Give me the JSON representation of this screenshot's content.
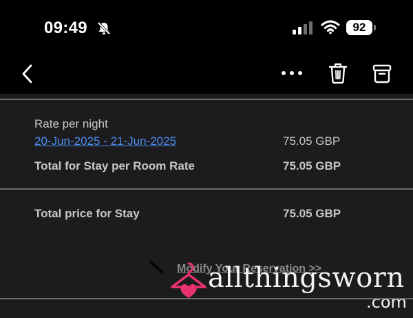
{
  "status_bar": {
    "time": "09:49",
    "battery": "92",
    "icons": [
      "bell-slash-icon",
      "cellular-signal-icon",
      "wifi-icon",
      "battery-icon"
    ]
  },
  "nav": {
    "icons": [
      "back-chevron-icon",
      "more-dots-icon",
      "trash-icon",
      "archive-icon"
    ]
  },
  "rate_section": {
    "heading": "Rate per night",
    "date_range": "20-Jun-2025 - 21-Jun-2025",
    "date_amount": "75.05 GBP",
    "total_label": "Total for Stay per Room Rate",
    "total_amount": "75.05 GBP"
  },
  "total_section": {
    "label": "Total price for Stay",
    "amount": "75.05 GBP"
  },
  "modify_link": "Modify Your Reservation >>",
  "watermark": {
    "name": "allthingsworn",
    "suffix": ".com"
  },
  "colors": {
    "link": "#4b8ef0",
    "background": "#1c1c1e",
    "topbar": "#000000",
    "watermark_accent": "#e8336e"
  }
}
